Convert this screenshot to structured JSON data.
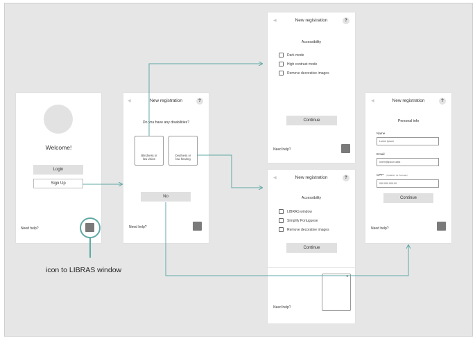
{
  "colors": {
    "board": "#e6e6e6",
    "connector": "#5fa8a4",
    "button": "#e0e0e0",
    "libras_square": "#7a7a7a"
  },
  "welcome_screen": {
    "title": "Welcome!",
    "login_label": "Login",
    "signup_label": "Sign Up",
    "need_help": "Need help?"
  },
  "disabilities_screen": {
    "header": "New registration",
    "help": "?",
    "question": "Do you have any disabilities?",
    "option_blind": "Blindness or\nlow vision",
    "option_deaf": "Deafness or\nlow hearing",
    "no_label": "No",
    "need_help": "Need help?"
  },
  "accessibility_visual_screen": {
    "header": "New registration",
    "help": "?",
    "section": "Accessibility",
    "options": [
      "Dark mode",
      "High contrast mode",
      "Remove decorative images"
    ],
    "continue_label": "Continue",
    "need_help": "Need help?"
  },
  "accessibility_hearing_screen": {
    "header": "New registration",
    "help": "?",
    "section": "Accessibility",
    "options": [
      "LIBRAS window",
      "Simplify Portuguese",
      "Remove decorative images"
    ],
    "continue_label": "Continue",
    "need_help": "Need help?",
    "libras_close": "x"
  },
  "personal_info_screen": {
    "header": "New registration",
    "help": "?",
    "section": "Personal info",
    "name_label": "Name",
    "name_value": "Lorem Ipsum",
    "email_label": "Email",
    "email_value": "lorem@ipsum.data",
    "cpf_label": "CPF*",
    "cpf_hint": "(Cadastro de Pessoas)",
    "cpf_value": "000.000.000-00",
    "continue_label": "Continue",
    "need_help": "Need help?"
  },
  "annotation": {
    "text": "icon to LIBRAS window"
  }
}
